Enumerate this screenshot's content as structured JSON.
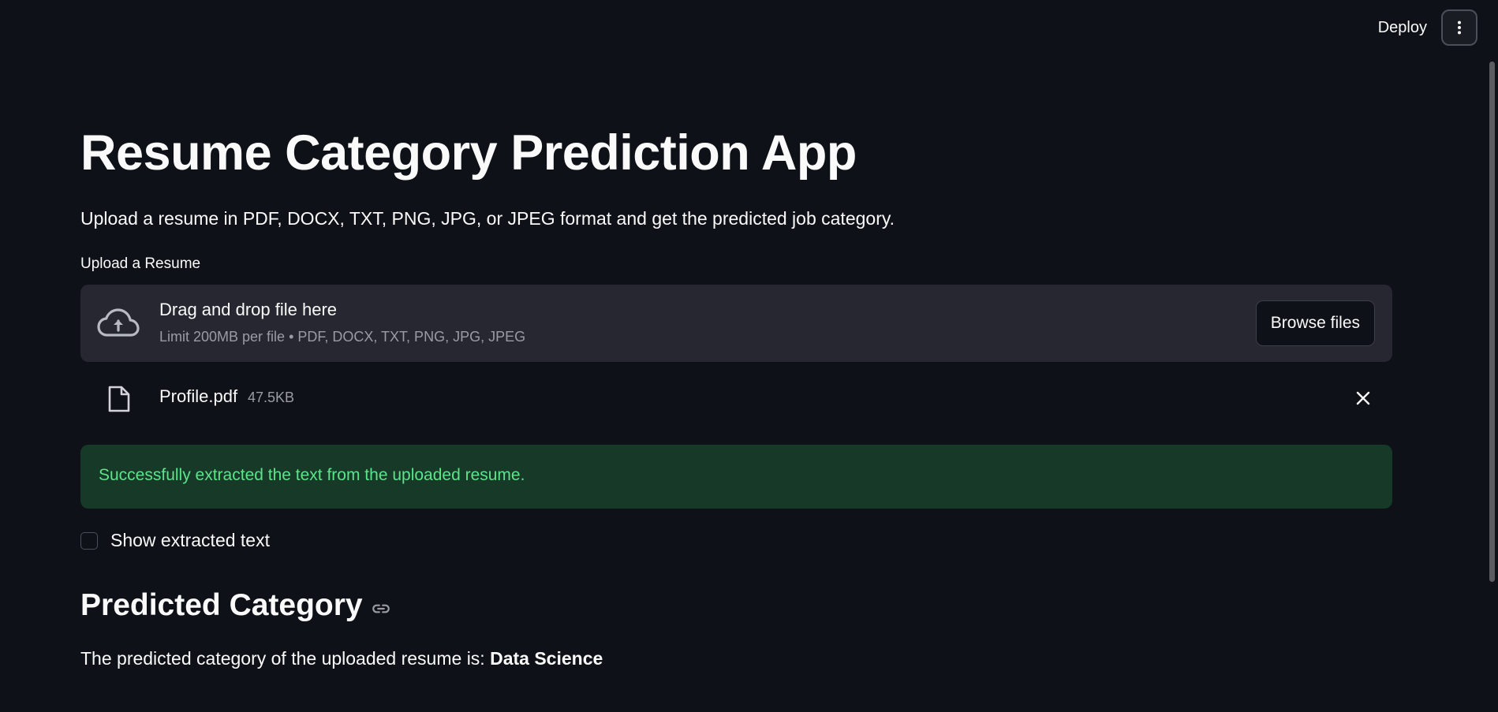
{
  "header": {
    "deploy_label": "Deploy",
    "menu_icon": "more-vertical-icon"
  },
  "main": {
    "title": "Resume Category Prediction App",
    "subtitle": "Upload a resume in PDF, DOCX, TXT, PNG, JPG, or JPEG format and get the predicted job category.",
    "uploader": {
      "label": "Upload a Resume",
      "dropzone_title": "Drag and drop file here",
      "dropzone_limit": "Limit 200MB per file • PDF, DOCX, TXT, PNG, JPG, JPEG",
      "browse_label": "Browse files",
      "icon": "cloud-upload-icon"
    },
    "uploaded_file": {
      "name": "Profile.pdf",
      "size": "47.5KB",
      "icon": "file-icon"
    },
    "success_message": "Successfully extracted the text from the uploaded resume.",
    "checkbox": {
      "label": "Show extracted text",
      "checked": false
    },
    "prediction": {
      "heading": "Predicted Category",
      "text_prefix": "The predicted category of the uploaded resume is:",
      "value": "Data Science"
    }
  },
  "colors": {
    "background": "#0e1117",
    "surface": "#262730",
    "success_bg": "#173928",
    "success_text": "#5ce488",
    "muted_text": "#9a9ca4"
  }
}
